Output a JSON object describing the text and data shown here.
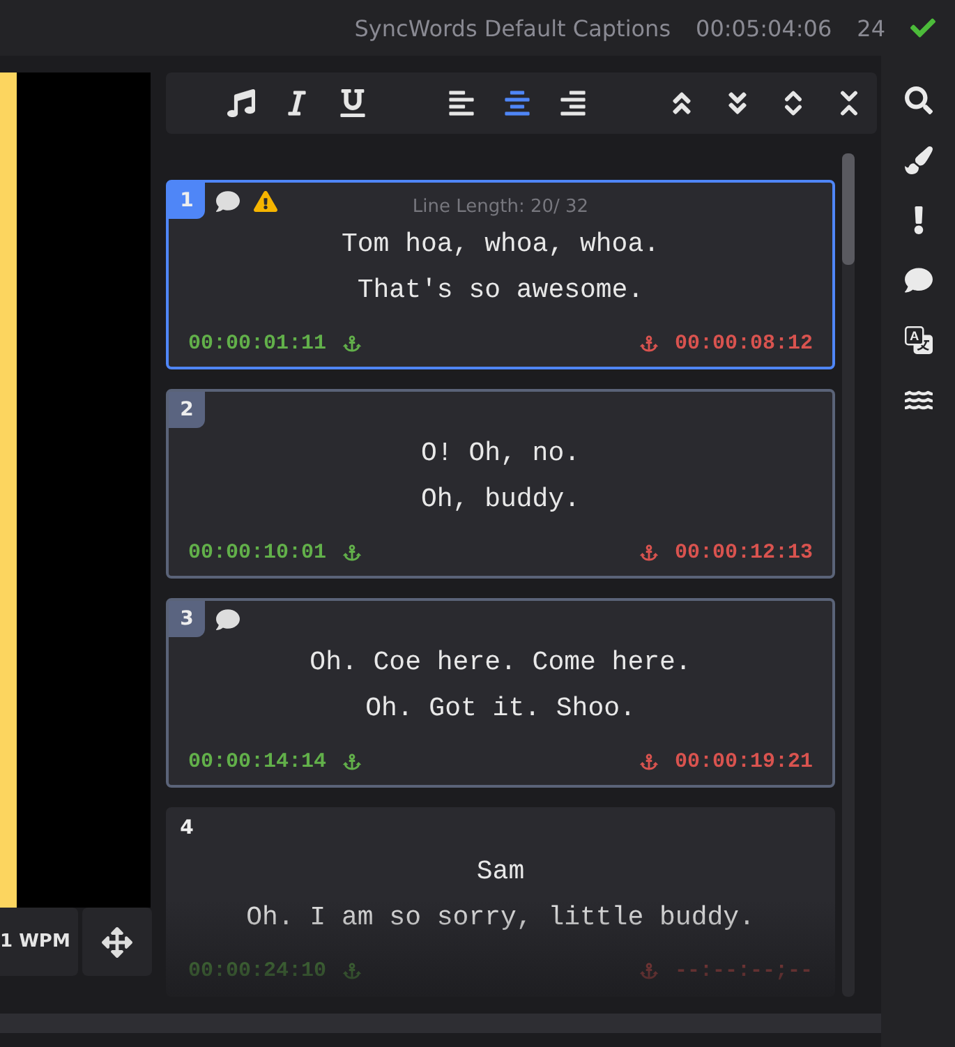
{
  "header": {
    "title": "SyncWords Default Captions",
    "timecode": "00:05:04:06",
    "count": "24",
    "saved": true
  },
  "player": {
    "wpm": "1 WPM"
  },
  "toolbar": [
    {
      "kind": "music",
      "selected": false
    },
    {
      "kind": "italic",
      "selected": false
    },
    {
      "kind": "underline",
      "selected": false
    },
    {
      "kind": "align-left",
      "selected": false
    },
    {
      "kind": "align-center",
      "selected": true
    },
    {
      "kind": "align-right",
      "selected": false
    },
    {
      "kind": "merge-up",
      "selected": false
    },
    {
      "kind": "merge-down",
      "selected": false
    },
    {
      "kind": "expand",
      "selected": false
    },
    {
      "kind": "collapse",
      "selected": false
    }
  ],
  "captions": [
    {
      "number": "1",
      "selected": true,
      "bordered": true,
      "comment": true,
      "warning": true,
      "line_length": "Line Length: 20/ 32",
      "lines": [
        "Tom hoa, whoa, whoa.",
        "That's so awesome."
      ],
      "start": "00:00:01:11",
      "end": "00:00:08:12"
    },
    {
      "number": "2",
      "selected": false,
      "bordered": true,
      "comment": false,
      "warning": false,
      "lines": [
        "O! Oh, no.",
        "Oh, buddy."
      ],
      "start": "00:00:10:01",
      "end": "00:00:12:13"
    },
    {
      "number": "3",
      "selected": false,
      "bordered": true,
      "comment": true,
      "warning": false,
      "lines": [
        "Oh. Coe here. Come here.",
        "Oh. Got it. Shoo."
      ],
      "start": "00:00:14:14",
      "end": "00:00:19:21"
    },
    {
      "number": "4",
      "selected": false,
      "bordered": false,
      "comment": false,
      "warning": false,
      "lines": [
        "Sam",
        "Oh. I am so sorry, little buddy."
      ],
      "start": "00:00:24:10",
      "end": "--:--:--;--"
    }
  ],
  "sidebar": [
    {
      "kind": "search"
    },
    {
      "kind": "brush"
    },
    {
      "kind": "alert"
    },
    {
      "kind": "comment"
    },
    {
      "kind": "translate"
    },
    {
      "kind": "waves"
    }
  ]
}
